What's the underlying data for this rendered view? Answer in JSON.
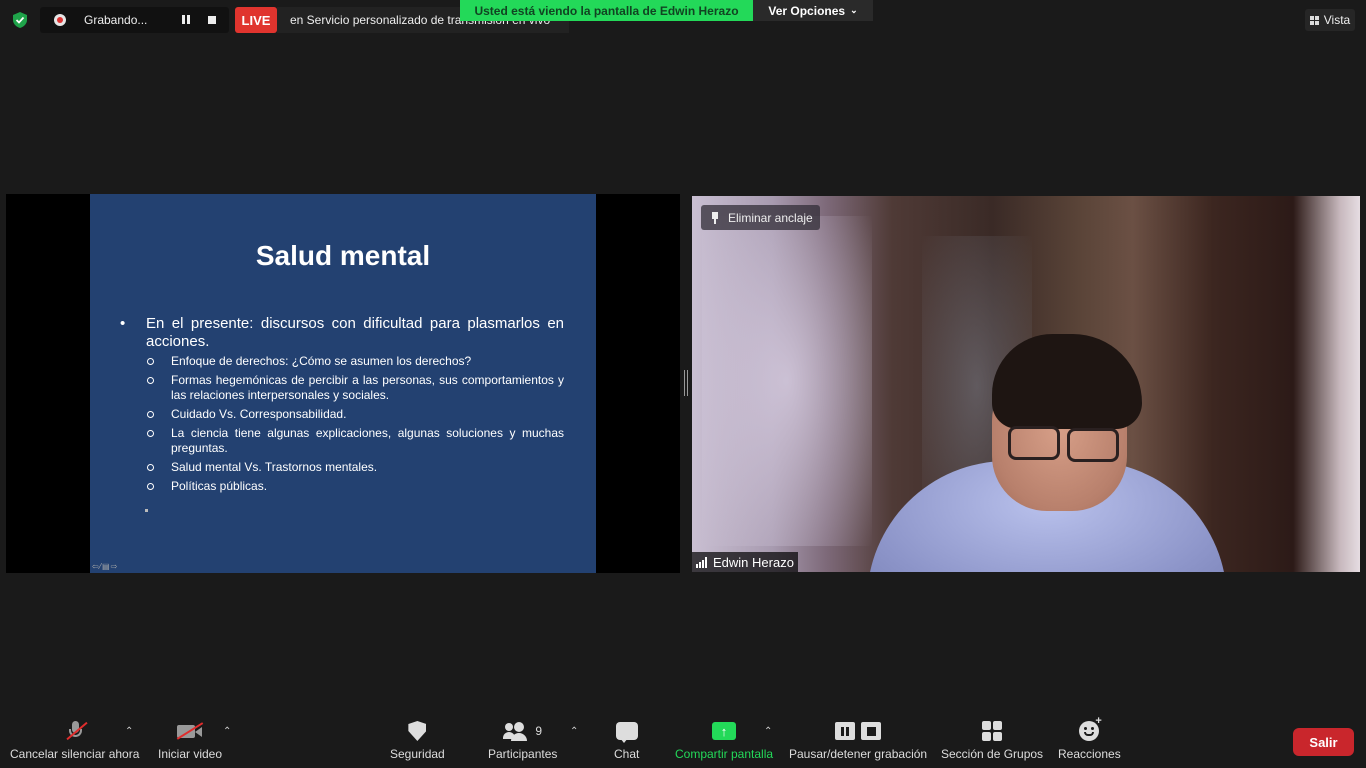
{
  "top_bar": {
    "recording_label": "Grabando...",
    "live_badge": "LIVE",
    "live_text": "en Servicio personalizado de transmisión en vivo",
    "viewing_banner": "Usted está viendo la pantalla de  Edwin Herazo",
    "view_options_label": "Ver Opciones",
    "vista_label": "Vista"
  },
  "shared_slide": {
    "title": "Salud mental",
    "bullet_marker": "•",
    "bullet": "En el presente: discursos con dificultad para plasmarlos en acciones.",
    "sub_items": [
      "Enfoque de derechos: ¿Cómo se asumen los derechos?",
      "Formas hegemónicas de percibir a las personas, sus comportamientos y las relaciones interpersonales y sociales.",
      "Cuidado Vs. Corresponsabilidad.",
      "La ciencia tiene algunas explicaciones, algunas soluciones y muchas preguntas.",
      "Salud mental Vs. Trastornos mentales.",
      "Políticas públicas."
    ],
    "controls": "⇦⁄▤⇨"
  },
  "video": {
    "unpin_label": "Eliminar anclaje",
    "participant_name": "Edwin Herazo"
  },
  "toolbar": {
    "mute_label": "Cancelar silenciar ahora",
    "video_label": "Iniciar video",
    "security_label": "Seguridad",
    "participants_label": "Participantes",
    "participants_count": "9",
    "chat_label": "Chat",
    "share_label": "Compartir pantalla",
    "pause_rec_label": "Pausar/detener grabación",
    "groups_label": "Sección de Grupos",
    "reactions_label": "Reacciones",
    "leave_label": "Salir",
    "caret": "⌃"
  },
  "colors": {
    "accent_green": "#23d959",
    "live_red": "#e0342e",
    "leave_red": "#c9262c",
    "slide_blue": "#234171",
    "background": "#1a1a1a"
  }
}
